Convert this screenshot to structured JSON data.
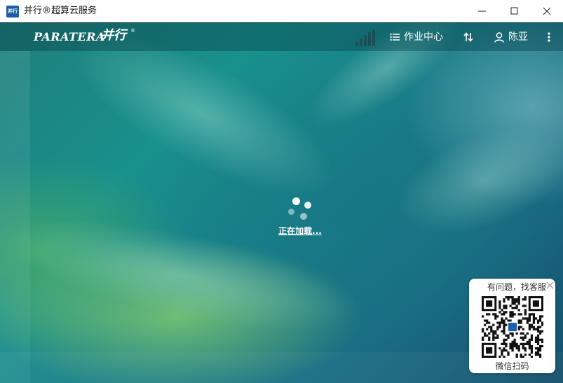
{
  "window": {
    "title": "并行®超算云服务",
    "app_icon_text": "并行"
  },
  "header": {
    "logo_text": "PARATERA",
    "logo_cn": "并行",
    "logo_reg": "®",
    "jobs_label": "作业中心",
    "user_name": "陈亚"
  },
  "loading": {
    "text": "正在加载..."
  },
  "support": {
    "title": "有问题，找客服",
    "scan_label": "微信扫码"
  },
  "colors": {
    "accent": "#1d5ea6",
    "header_text": "#ffffff"
  }
}
